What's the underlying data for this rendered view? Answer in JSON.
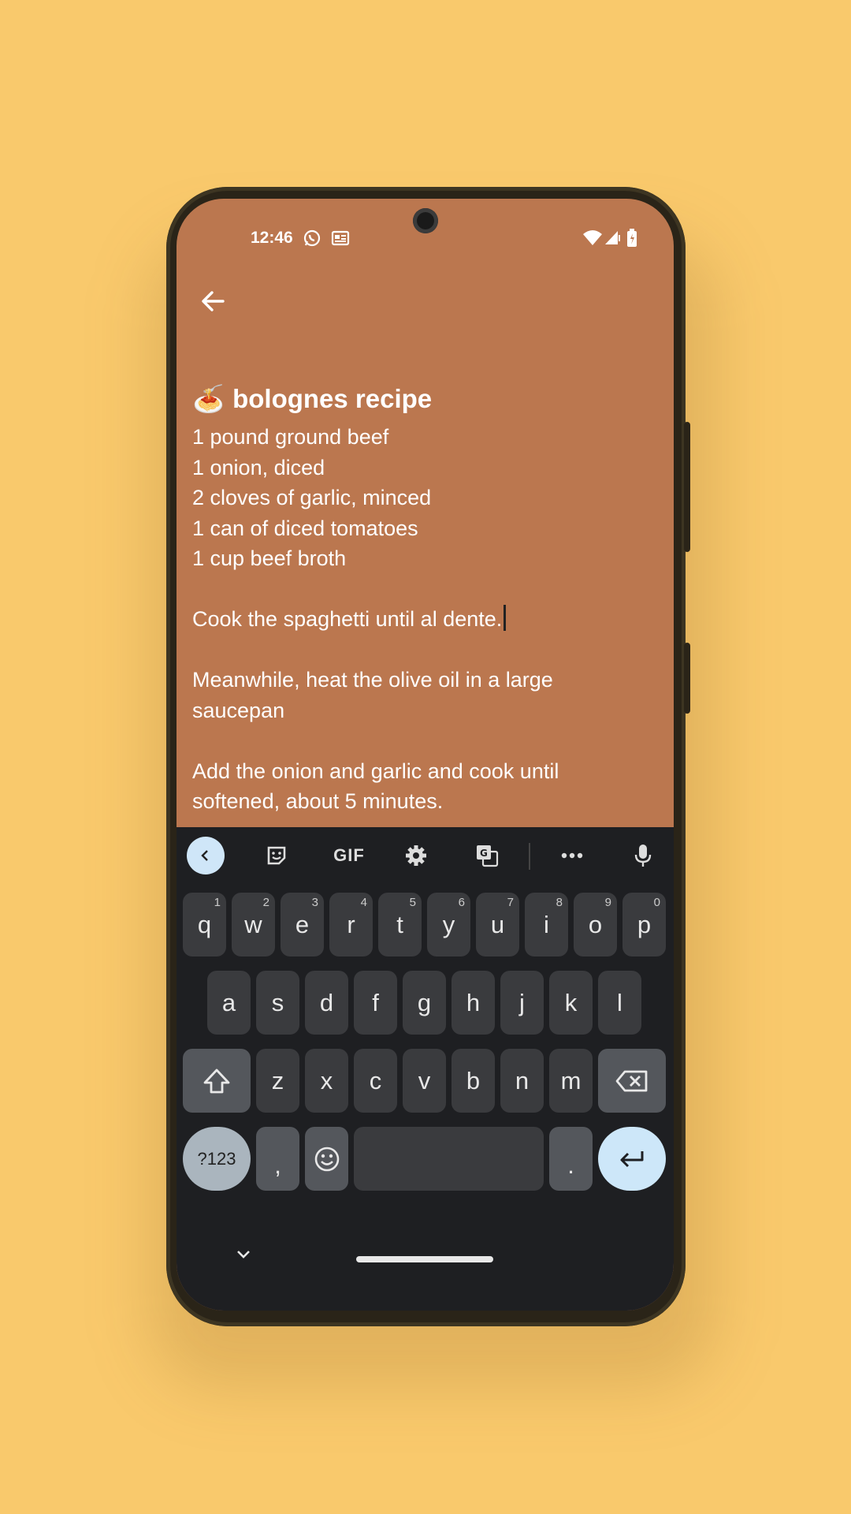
{
  "status_bar": {
    "time": "12:46",
    "icons_left": [
      "whatsapp-icon",
      "news-icon"
    ],
    "icons_right": [
      "wifi-icon",
      "signal-icon",
      "battery-icon"
    ]
  },
  "app_bar": {
    "back_icon": "arrow-back-icon"
  },
  "note": {
    "title_emoji": "🍝",
    "title": "bolognes  recipe",
    "lines": [
      "1 pound ground beef",
      "1 onion, diced",
      "2 cloves of garlic, minced",
      "1 can of diced tomatoes",
      "1 cup beef broth",
      "",
      "Cook the spaghetti until al dente.",
      "",
      "Meanwhile, heat the olive oil in a large",
      "saucepan",
      "",
      "Add the onion and garlic and cook until",
      "softened, about 5 minutes."
    ]
  },
  "keyboard": {
    "toolbar": [
      "back-icon",
      "sticker-icon",
      "GIF",
      "gear-icon",
      "translate-icon",
      "more-icon",
      "mic-icon"
    ],
    "gif_label": "GIF",
    "row1": [
      {
        "k": "q",
        "n": "1"
      },
      {
        "k": "w",
        "n": "2"
      },
      {
        "k": "e",
        "n": "3"
      },
      {
        "k": "r",
        "n": "4"
      },
      {
        "k": "t",
        "n": "5"
      },
      {
        "k": "y",
        "n": "6"
      },
      {
        "k": "u",
        "n": "7"
      },
      {
        "k": "i",
        "n": "8"
      },
      {
        "k": "o",
        "n": "9"
      },
      {
        "k": "p",
        "n": "0"
      }
    ],
    "row2": [
      "a",
      "s",
      "d",
      "f",
      "g",
      "h",
      "j",
      "k",
      "l"
    ],
    "row3": [
      "z",
      "x",
      "c",
      "v",
      "b",
      "n",
      "m"
    ],
    "symbols_label": "?123",
    "comma": ",",
    "period": "."
  },
  "colors": {
    "background": "#F9C96C",
    "note_bg": "#BB774F",
    "keyboard_bg": "#1E1F22",
    "key_bg": "#3A3B3E",
    "accent": "#CFE6F8"
  }
}
